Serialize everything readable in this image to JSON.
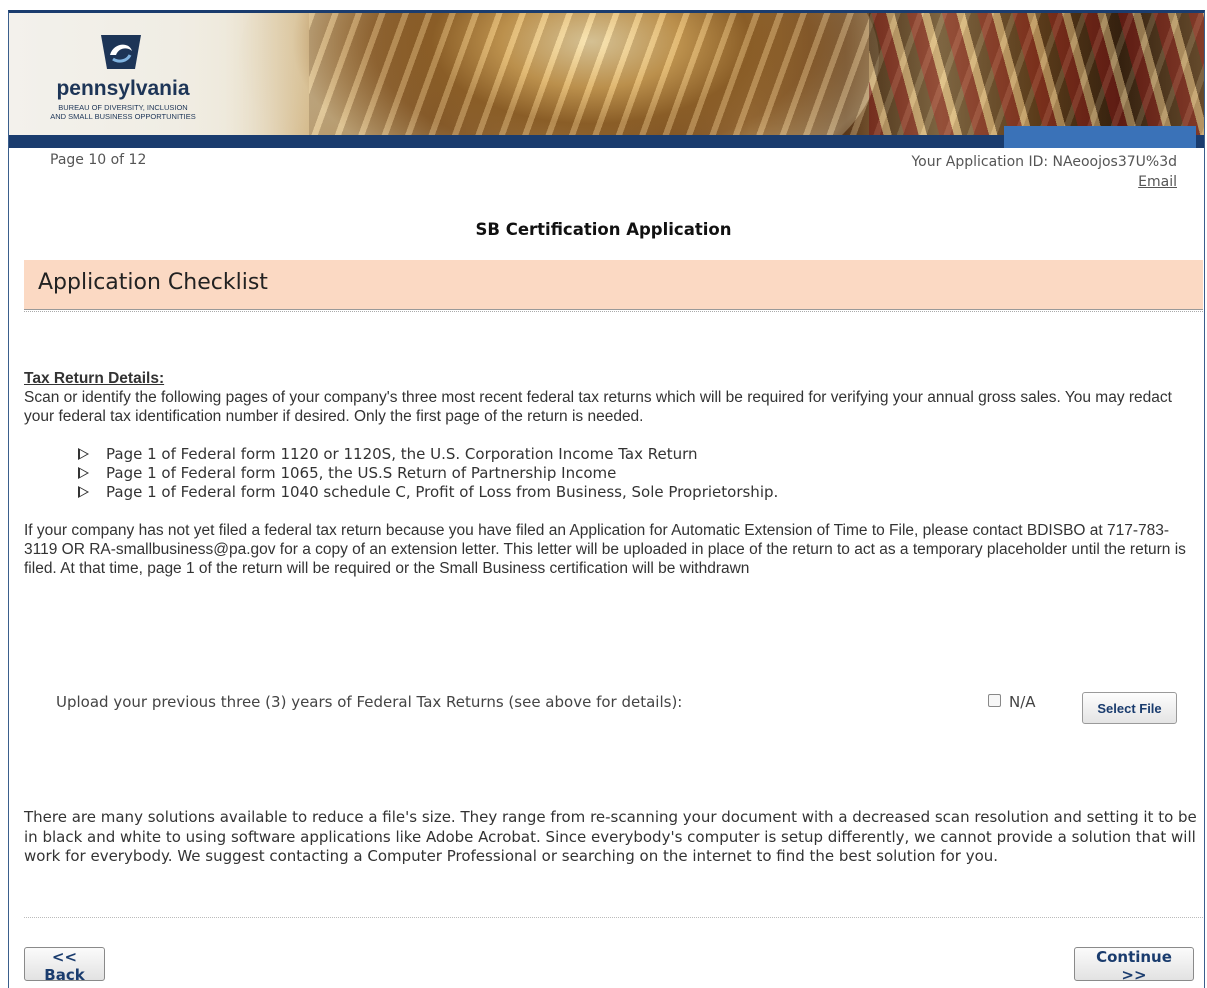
{
  "header": {
    "logo_name": "pennsylvania",
    "bureau_line1": "BUREAU OF DIVERSITY, INCLUSION",
    "bureau_line2": "AND SMALL BUSINESS OPPORTUNITIES"
  },
  "meta": {
    "page_indicator": "Page 10 of 12",
    "application_id": "Your Application ID: NAeoojos37U%3d",
    "email_link": "Email"
  },
  "form_title": "SB Certification Application",
  "section_title": "Application Checklist",
  "tax": {
    "heading": "Tax Return Details:",
    "intro": "Scan or identify the following pages of your company's three most recent federal tax returns which will be required for verifying your annual gross sales. You may redact your federal tax identification number if desired. Only the first page of the return is needed.",
    "bullets": [
      "Page 1 of Federal form 1120 or 1120S, the U.S. Corporation Income Tax Return",
      "Page 1 of Federal form 1065, the US.S Return of Partnership Income",
      "Page 1 of Federal form 1040 schedule C, Profit of Loss from Business, Sole Proprietorship."
    ],
    "extension": "If your company has not yet filed a federal tax return because you have filed an Application for Automatic Extension of Time to File, please contact BDISBO at 717-783-3119 OR RA-smallbusiness@pa.gov for a copy of an extension letter. This letter will be uploaded in place of the return to act as a temporary placeholder until the return is filed. At that time, page 1 of the return will be required or the Small Business certification will be withdrawn"
  },
  "upload": {
    "label": "Upload your previous three (3) years of Federal Tax Returns (see above for details):",
    "na_label": "N/A",
    "select_file": "Select File"
  },
  "size_note": "There are many solutions available to reduce a file's size. They range from re-scanning your document with a decreased scan resolution and setting it to be in black and white to using software applications like Adobe Acrobat. Since everybody's computer is setup differently, we cannot provide a solution that will work for everybody. We suggest contacting a Computer Professional or searching on the internet to find the best solution for you.",
  "nav": {
    "back": "<< Back",
    "continue": "Continue >>"
  },
  "colors": {
    "navy": "#1a3c6e",
    "section_bg": "#fbd9c3",
    "blue_tab": "#3a72b8"
  }
}
